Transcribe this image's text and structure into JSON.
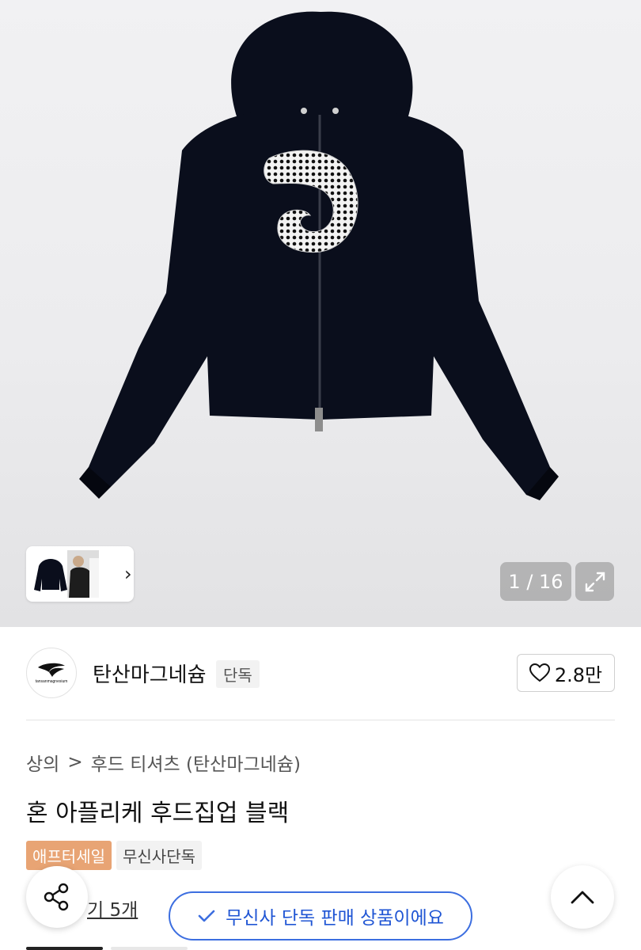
{
  "gallery": {
    "counter": "1 / 16",
    "thumb_items": [
      "product-thumbnail",
      "model-thumbnail"
    ]
  },
  "brand": {
    "logo_text": "tansanmagnesium",
    "name": "탄산마그네슘",
    "tag": "단독",
    "likes": "2.8만"
  },
  "breadcrumb": {
    "category": "상의",
    "separator": ">",
    "subcategory": "후드 티셔츠 (탄산마그네슘)"
  },
  "product": {
    "title": "혼 아플리케 후드집업 블랙",
    "badges": [
      "애프터세일",
      "무신사단독"
    ],
    "review_link": "기 5개"
  },
  "notice": {
    "text": "무신사 단독 판매 상품이에요"
  },
  "icons": {
    "share": "share-icon",
    "top": "chevron-up-icon",
    "expand": "expand-icon",
    "heart": "heart-icon",
    "check": "check-icon",
    "chevron": "chevron-right-icon"
  },
  "colors": {
    "accent_blue": "#3c6ee0",
    "sale_badge": "#e8a474"
  }
}
